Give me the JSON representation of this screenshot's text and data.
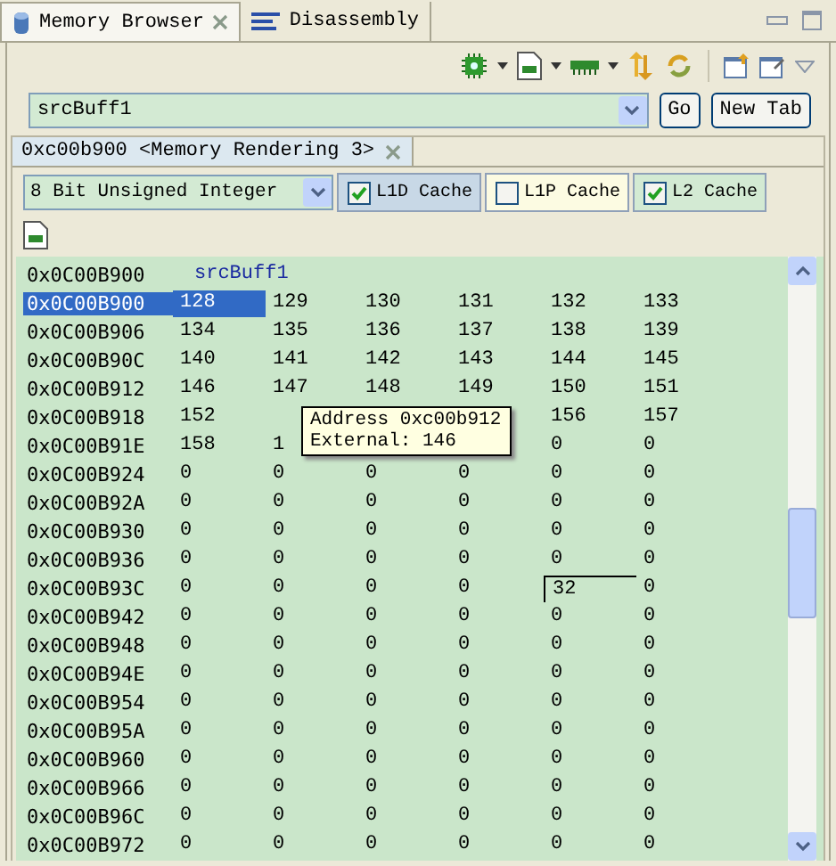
{
  "view_tabs": [
    {
      "label": "Memory Browser",
      "selected": true,
      "kind": "memory"
    },
    {
      "label": "Disassembly",
      "selected": false,
      "kind": "disassembly"
    }
  ],
  "address_field": {
    "value": "srcBuff1"
  },
  "address_buttons": [
    "Go",
    "New Tab"
  ],
  "rendering_tab": {
    "label": "0xc00b900 <Memory Rendering 3>"
  },
  "format_select": {
    "value": "8 Bit Unsigned Integer"
  },
  "cache_options": [
    {
      "label": "L1D Cache",
      "checked": true,
      "color": "#c8d8e6"
    },
    {
      "label": "L1P Cache",
      "checked": false,
      "color": "#fcfbe2"
    },
    {
      "label": "L2 Cache",
      "checked": true,
      "color": "#d3ead3"
    }
  ],
  "memory": {
    "label_row": {
      "address": "0x0C00B900",
      "symbol": "srcBuff1"
    },
    "rows": [
      {
        "address": "0x0C00B900",
        "selected": true,
        "cells": [
          {
            "value": "128",
            "selected": true,
            "editing": false
          },
          {
            "value": "129",
            "selected": false,
            "editing": false
          },
          {
            "value": "130",
            "selected": false,
            "editing": false
          },
          {
            "value": "131",
            "selected": false,
            "editing": false
          },
          {
            "value": "132",
            "selected": false,
            "editing": false
          },
          {
            "value": "133",
            "selected": false,
            "editing": false
          }
        ]
      },
      {
        "address": "0x0C00B906",
        "selected": false,
        "cells": [
          {
            "value": "134",
            "selected": false,
            "editing": false
          },
          {
            "value": "135",
            "selected": false,
            "editing": false
          },
          {
            "value": "136",
            "selected": false,
            "editing": false
          },
          {
            "value": "137",
            "selected": false,
            "editing": false
          },
          {
            "value": "138",
            "selected": false,
            "editing": false
          },
          {
            "value": "139",
            "selected": false,
            "editing": false
          }
        ]
      },
      {
        "address": "0x0C00B90C",
        "selected": false,
        "cells": [
          {
            "value": "140",
            "selected": false,
            "editing": false
          },
          {
            "value": "141",
            "selected": false,
            "editing": false
          },
          {
            "value": "142",
            "selected": false,
            "editing": false
          },
          {
            "value": "143",
            "selected": false,
            "editing": false
          },
          {
            "value": "144",
            "selected": false,
            "editing": false
          },
          {
            "value": "145",
            "selected": false,
            "editing": false
          }
        ]
      },
      {
        "address": "0x0C00B912",
        "selected": false,
        "cells": [
          {
            "value": "146",
            "selected": false,
            "editing": false
          },
          {
            "value": "147",
            "selected": false,
            "editing": false
          },
          {
            "value": "148",
            "selected": false,
            "editing": false
          },
          {
            "value": "149",
            "selected": false,
            "editing": false
          },
          {
            "value": "150",
            "selected": false,
            "editing": false
          },
          {
            "value": "151",
            "selected": false,
            "editing": false
          }
        ]
      },
      {
        "address": "0x0C00B918",
        "selected": false,
        "cells": [
          {
            "value": "152",
            "selected": false,
            "editing": false
          },
          null,
          null,
          null,
          {
            "value": "156",
            "selected": false,
            "editing": false
          },
          {
            "value": "157",
            "selected": false,
            "editing": false
          }
        ]
      },
      {
        "address": "0x0C00B91E",
        "selected": false,
        "cells": [
          {
            "value": "158",
            "selected": false,
            "editing": false
          },
          {
            "value": "1",
            "selected": false,
            "editing": false
          },
          null,
          null,
          {
            "value": "0",
            "selected": false,
            "editing": false
          },
          {
            "value": "0",
            "selected": false,
            "editing": false
          }
        ]
      },
      {
        "address": "0x0C00B924",
        "selected": false,
        "cells": [
          {
            "value": "0",
            "selected": false,
            "editing": false
          },
          {
            "value": "0",
            "selected": false,
            "editing": false
          },
          {
            "value": "0",
            "selected": false,
            "editing": false
          },
          {
            "value": "0",
            "selected": false,
            "editing": false
          },
          {
            "value": "0",
            "selected": false,
            "editing": false
          },
          {
            "value": "0",
            "selected": false,
            "editing": false
          }
        ]
      },
      {
        "address": "0x0C00B92A",
        "selected": false,
        "cells": [
          {
            "value": "0",
            "selected": false,
            "editing": false
          },
          {
            "value": "0",
            "selected": false,
            "editing": false
          },
          {
            "value": "0",
            "selected": false,
            "editing": false
          },
          {
            "value": "0",
            "selected": false,
            "editing": false
          },
          {
            "value": "0",
            "selected": false,
            "editing": false
          },
          {
            "value": "0",
            "selected": false,
            "editing": false
          }
        ]
      },
      {
        "address": "0x0C00B930",
        "selected": false,
        "cells": [
          {
            "value": "0",
            "selected": false,
            "editing": false
          },
          {
            "value": "0",
            "selected": false,
            "editing": false
          },
          {
            "value": "0",
            "selected": false,
            "editing": false
          },
          {
            "value": "0",
            "selected": false,
            "editing": false
          },
          {
            "value": "0",
            "selected": false,
            "editing": false
          },
          {
            "value": "0",
            "selected": false,
            "editing": false
          }
        ]
      },
      {
        "address": "0x0C00B936",
        "selected": false,
        "cells": [
          {
            "value": "0",
            "selected": false,
            "editing": false
          },
          {
            "value": "0",
            "selected": false,
            "editing": false
          },
          {
            "value": "0",
            "selected": false,
            "editing": false
          },
          {
            "value": "0",
            "selected": false,
            "editing": false
          },
          {
            "value": "0",
            "selected": false,
            "editing": false
          },
          {
            "value": "0",
            "selected": false,
            "editing": false
          }
        ]
      },
      {
        "address": "0x0C00B93C",
        "selected": false,
        "cells": [
          {
            "value": "0",
            "selected": false,
            "editing": false
          },
          {
            "value": "0",
            "selected": false,
            "editing": false
          },
          {
            "value": "0",
            "selected": false,
            "editing": false
          },
          {
            "value": "0",
            "selected": false,
            "editing": false
          },
          {
            "value": "32",
            "selected": false,
            "editing": true
          },
          {
            "value": "0",
            "selected": false,
            "editing": false
          }
        ]
      },
      {
        "address": "0x0C00B942",
        "selected": false,
        "cells": [
          {
            "value": "0",
            "selected": false,
            "editing": false
          },
          {
            "value": "0",
            "selected": false,
            "editing": false
          },
          {
            "value": "0",
            "selected": false,
            "editing": false
          },
          {
            "value": "0",
            "selected": false,
            "editing": false
          },
          {
            "value": "0",
            "selected": false,
            "editing": false
          },
          {
            "value": "0",
            "selected": false,
            "editing": false
          }
        ]
      },
      {
        "address": "0x0C00B948",
        "selected": false,
        "cells": [
          {
            "value": "0",
            "selected": false,
            "editing": false
          },
          {
            "value": "0",
            "selected": false,
            "editing": false
          },
          {
            "value": "0",
            "selected": false,
            "editing": false
          },
          {
            "value": "0",
            "selected": false,
            "editing": false
          },
          {
            "value": "0",
            "selected": false,
            "editing": false
          },
          {
            "value": "0",
            "selected": false,
            "editing": false
          }
        ]
      },
      {
        "address": "0x0C00B94E",
        "selected": false,
        "cells": [
          {
            "value": "0",
            "selected": false,
            "editing": false
          },
          {
            "value": "0",
            "selected": false,
            "editing": false
          },
          {
            "value": "0",
            "selected": false,
            "editing": false
          },
          {
            "value": "0",
            "selected": false,
            "editing": false
          },
          {
            "value": "0",
            "selected": false,
            "editing": false
          },
          {
            "value": "0",
            "selected": false,
            "editing": false
          }
        ]
      },
      {
        "address": "0x0C00B954",
        "selected": false,
        "cells": [
          {
            "value": "0",
            "selected": false,
            "editing": false
          },
          {
            "value": "0",
            "selected": false,
            "editing": false
          },
          {
            "value": "0",
            "selected": false,
            "editing": false
          },
          {
            "value": "0",
            "selected": false,
            "editing": false
          },
          {
            "value": "0",
            "selected": false,
            "editing": false
          },
          {
            "value": "0",
            "selected": false,
            "editing": false
          }
        ]
      },
      {
        "address": "0x0C00B95A",
        "selected": false,
        "cells": [
          {
            "value": "0",
            "selected": false,
            "editing": false
          },
          {
            "value": "0",
            "selected": false,
            "editing": false
          },
          {
            "value": "0",
            "selected": false,
            "editing": false
          },
          {
            "value": "0",
            "selected": false,
            "editing": false
          },
          {
            "value": "0",
            "selected": false,
            "editing": false
          },
          {
            "value": "0",
            "selected": false,
            "editing": false
          }
        ]
      },
      {
        "address": "0x0C00B960",
        "selected": false,
        "cells": [
          {
            "value": "0",
            "selected": false,
            "editing": false
          },
          {
            "value": "0",
            "selected": false,
            "editing": false
          },
          {
            "value": "0",
            "selected": false,
            "editing": false
          },
          {
            "value": "0",
            "selected": false,
            "editing": false
          },
          {
            "value": "0",
            "selected": false,
            "editing": false
          },
          {
            "value": "0",
            "selected": false,
            "editing": false
          }
        ]
      },
      {
        "address": "0x0C00B966",
        "selected": false,
        "cells": [
          {
            "value": "0",
            "selected": false,
            "editing": false
          },
          {
            "value": "0",
            "selected": false,
            "editing": false
          },
          {
            "value": "0",
            "selected": false,
            "editing": false
          },
          {
            "value": "0",
            "selected": false,
            "editing": false
          },
          {
            "value": "0",
            "selected": false,
            "editing": false
          },
          {
            "value": "0",
            "selected": false,
            "editing": false
          }
        ]
      },
      {
        "address": "0x0C00B96C",
        "selected": false,
        "cells": [
          {
            "value": "0",
            "selected": false,
            "editing": false
          },
          {
            "value": "0",
            "selected": false,
            "editing": false
          },
          {
            "value": "0",
            "selected": false,
            "editing": false
          },
          {
            "value": "0",
            "selected": false,
            "editing": false
          },
          {
            "value": "0",
            "selected": false,
            "editing": false
          },
          {
            "value": "0",
            "selected": false,
            "editing": false
          }
        ]
      },
      {
        "address": "0x0C00B972",
        "selected": false,
        "cells": [
          {
            "value": "0",
            "selected": false,
            "editing": false
          },
          {
            "value": "0",
            "selected": false,
            "editing": false
          },
          {
            "value": "0",
            "selected": false,
            "editing": false
          },
          {
            "value": "0",
            "selected": false,
            "editing": false
          },
          {
            "value": "0",
            "selected": false,
            "editing": false
          },
          {
            "value": "0",
            "selected": false,
            "editing": false
          }
        ]
      }
    ]
  },
  "tooltip": {
    "lines": [
      "Address 0xc00b912",
      "External: 146"
    ]
  }
}
